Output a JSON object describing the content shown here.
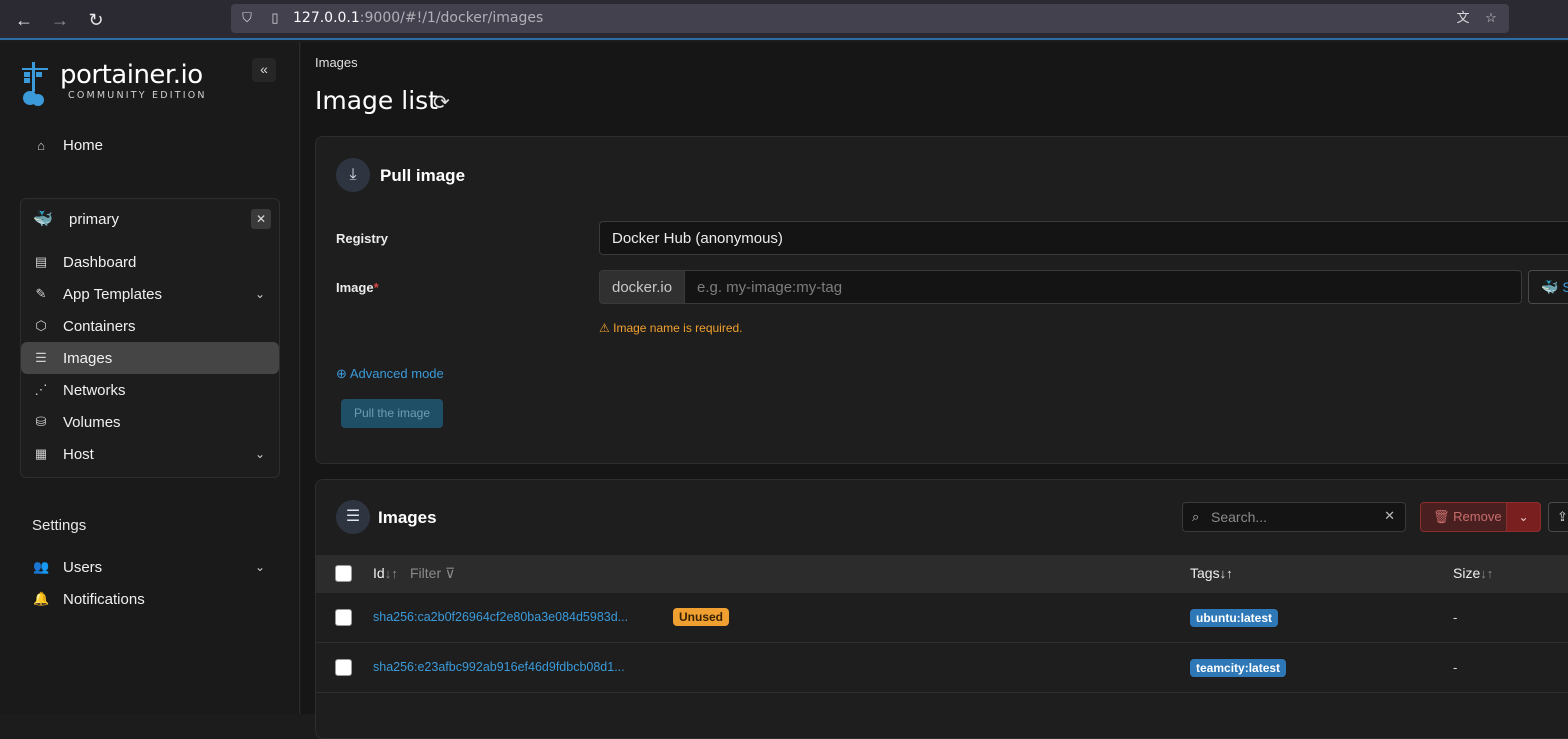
{
  "browser": {
    "url_host": "127.0.0.1",
    "url_rest": ":9000/#!/1/docker/images"
  },
  "sidebar": {
    "logo_text": "portainer.io",
    "logo_sub": "COMMUNITY EDITION",
    "home_label": "Home",
    "environment": {
      "name": "primary",
      "items": [
        {
          "label": "Dashboard",
          "icon": "dashboard-icon"
        },
        {
          "label": "App Templates",
          "icon": "edit-icon"
        },
        {
          "label": "Containers",
          "icon": "cube-icon"
        },
        {
          "label": "Images",
          "icon": "list-icon"
        },
        {
          "label": "Networks",
          "icon": "share-icon"
        },
        {
          "label": "Volumes",
          "icon": "database-icon"
        },
        {
          "label": "Host",
          "icon": "host-icon"
        }
      ]
    },
    "settings_label": "Settings",
    "users_label": "Users",
    "notifications_label": "Notifications"
  },
  "main": {
    "breadcrumb": "Images",
    "title": "Image list",
    "pull": {
      "title": "Pull image",
      "registry_label": "Registry",
      "registry_value": "Docker Hub (anonymous)",
      "image_label": "Image",
      "image_required_mark": "*",
      "image_prefix": "docker.io",
      "image_placeholder": "e.g. my-image:my-tag",
      "search_button": "S",
      "warning": "Image name is required.",
      "advanced_link": "Advanced mode",
      "pull_button": "Pull the image"
    },
    "images": {
      "title": "Images",
      "search_placeholder": "Search...",
      "remove_label": "Remove",
      "columns": {
        "id": "Id",
        "filter": "Filter",
        "tags": "Tags",
        "size": "Size"
      },
      "rows": [
        {
          "id": "sha256:ca2b0f26964cf2e80ba3e084d5983d...",
          "badge": "Unused",
          "tag": "ubuntu:latest",
          "size": "-"
        },
        {
          "id": "sha256:e23afbc992ab916ef46d9fdbcb08d1...",
          "badge": "",
          "tag": "teamcity:latest",
          "size": "-"
        }
      ]
    }
  }
}
